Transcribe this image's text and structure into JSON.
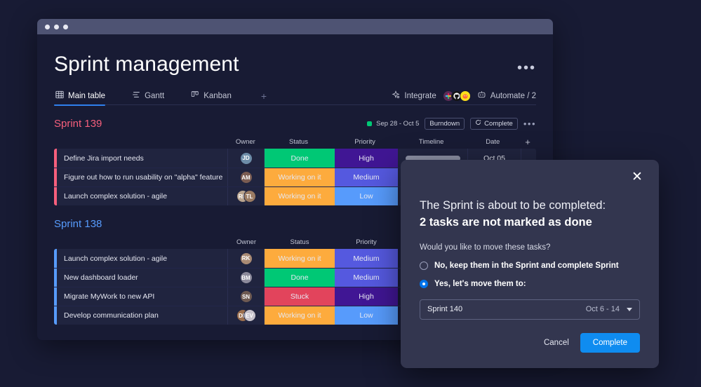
{
  "window": {
    "title_dots": 3
  },
  "header": {
    "title": "Sprint management",
    "menu_glyph": "•••"
  },
  "tabs": {
    "items": [
      {
        "label": "Main table",
        "icon": "table-icon",
        "active": true
      },
      {
        "label": "Gantt",
        "icon": "gantt-icon",
        "active": false
      },
      {
        "label": "Kanban",
        "icon": "kanban-icon",
        "active": false
      }
    ],
    "add_label": "+"
  },
  "tools": {
    "integrate_label": "Integrate",
    "automate_label": "Automate / 2",
    "integration_avatars": [
      "slack-icon",
      "github-icon",
      "mailchimp-icon"
    ]
  },
  "columns": {
    "owner": "Owner",
    "status": "Status",
    "priority": "Priority",
    "timeline": "Timeline",
    "date": "Date",
    "add": "+"
  },
  "colors": {
    "done": "#00c875",
    "working": "#fdab3d",
    "stuck": "#e2445c",
    "high": "#401694",
    "medium": "#5559df",
    "low": "#579bfc",
    "accent_sprint139": "#f65f7c",
    "accent_sprint138": "#579bfc",
    "brand_blue": "#0f8cf0"
  },
  "groups": [
    {
      "title": "Sprint 139",
      "title_color": "#f65f7c",
      "accent": "#f65f7c",
      "date_range": "Sep 28 - Oct 5",
      "burndown_label": "Burndown",
      "complete_label": "Complete",
      "menu_glyph": "•••",
      "show_timeline_date": true,
      "rows": [
        {
          "name": "Define Jira import needs",
          "owners": [
            {
              "initials": "JD",
              "color": "#6d8ca8"
            }
          ],
          "status": "Done",
          "status_color": "#00c875",
          "priority": "High",
          "priority_color": "#401694",
          "timeline_pct": 30,
          "date": "Oct 05"
        },
        {
          "name": "Figure out how to run usability on \"alpha\" feature",
          "owners": [
            {
              "initials": "AM",
              "color": "#7a5c52"
            }
          ],
          "status": "Working on it",
          "status_color": "#fdab3d",
          "priority": "Medium",
          "priority_color": "#5559df",
          "timeline_pct": 0,
          "date": ""
        },
        {
          "name": "Launch complex solution - agile",
          "owners": [
            {
              "initials": "RK",
              "color": "#b9a48f"
            },
            {
              "initials": "TL",
              "color": "#9a7b63"
            }
          ],
          "status": "Working on it",
          "status_color": "#fdab3d",
          "priority": "Low",
          "priority_color": "#579bfc",
          "timeline_pct": 0,
          "date": ""
        }
      ]
    },
    {
      "title": "Sprint 138",
      "title_color": "#579bfc",
      "accent": "#579bfc",
      "date_range": "",
      "burndown_label": "",
      "complete_label": "",
      "menu_glyph": "",
      "show_timeline_date": false,
      "rows": [
        {
          "name": "Launch complex solution - agile",
          "owners": [
            {
              "initials": "RK",
              "color": "#a98a74"
            }
          ],
          "status": "Working on it",
          "status_color": "#fdab3d",
          "priority": "Medium",
          "priority_color": "#5559df",
          "timeline_pct": 0,
          "date": ""
        },
        {
          "name": "New dashboard loader",
          "owners": [
            {
              "initials": "BM",
              "color": "#8c8a9b"
            }
          ],
          "status": "Done",
          "status_color": "#00c875",
          "priority": "Medium",
          "priority_color": "#5559df",
          "timeline_pct": 0,
          "date": ""
        },
        {
          "name": "Migrate MyWork to new API",
          "owners": [
            {
              "initials": "SN",
              "color": "#6e5a52"
            }
          ],
          "status": "Stuck",
          "status_color": "#e2445c",
          "priority": "High",
          "priority_color": "#401694",
          "timeline_pct": 0,
          "date": ""
        },
        {
          "name": "Develop communication plan",
          "owners": [
            {
              "initials": "DP",
              "color": "#9c6f4e"
            },
            {
              "initials": "EV",
              "color": "#c7c3cc"
            }
          ],
          "status": "Working on it",
          "status_color": "#fdab3d",
          "priority": "Low",
          "priority_color": "#579bfc",
          "timeline_pct": 0,
          "date": ""
        }
      ]
    }
  ],
  "modal": {
    "close_glyph": "✕",
    "title": "The Sprint is about to be completed:",
    "subtitle": "2 tasks are not marked as done",
    "question": "Would you like to move these tasks?",
    "options": [
      {
        "label": "No, keep them in the Sprint and complete Sprint",
        "checked": false
      },
      {
        "label": "Yes, let's move them to:",
        "checked": true
      }
    ],
    "select": {
      "value": "Sprint 140",
      "date": "Oct 6 - 14"
    },
    "cancel_label": "Cancel",
    "complete_label": "Complete"
  }
}
